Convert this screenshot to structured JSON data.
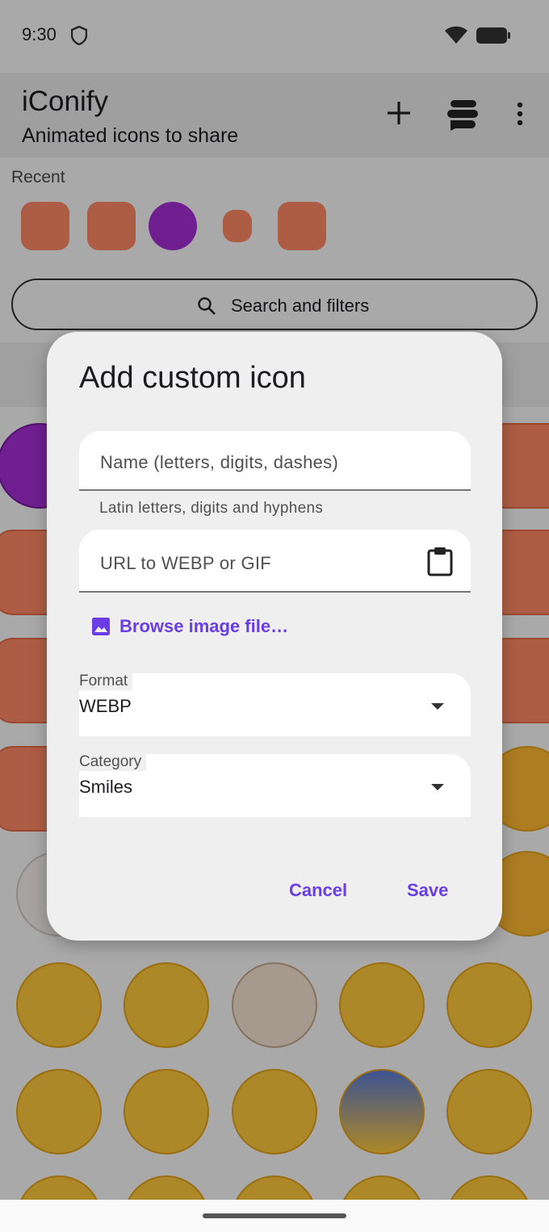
{
  "status_bar": {
    "time": "9:30",
    "icons": [
      "shield-icon",
      "wifi-icon",
      "battery-icon"
    ]
  },
  "app_bar": {
    "title": "iConify",
    "subtitle": "Animated icons to share",
    "actions": [
      "add-icon",
      "stack-icon",
      "more-vert-icon"
    ]
  },
  "recent": {
    "label": "Recent",
    "items": [
      "blob-surprised",
      "blob-crying",
      "smiling-imp",
      "blob-small",
      "blob-relieved"
    ]
  },
  "search": {
    "label": "Search and filters"
  },
  "dialog": {
    "title": "Add custom icon",
    "name_field": {
      "placeholder": "Name (letters, digits, dashes)",
      "supporting_text": "Latin letters, digits and hyphens"
    },
    "url_field": {
      "placeholder": "URL to WEBP or GIF"
    },
    "browse_label": "Browse image file…",
    "format": {
      "label": "Format",
      "value": "WEBP"
    },
    "category": {
      "label": "Category",
      "value": "Smiles"
    },
    "cancel_label": "Cancel",
    "save_label": "Save"
  },
  "colors": {
    "accent": "#6a3de8",
    "dialog_bg": "#efefef",
    "field_bg": "#ffffff",
    "scrim": "rgba(0,0,0,0.32)"
  }
}
